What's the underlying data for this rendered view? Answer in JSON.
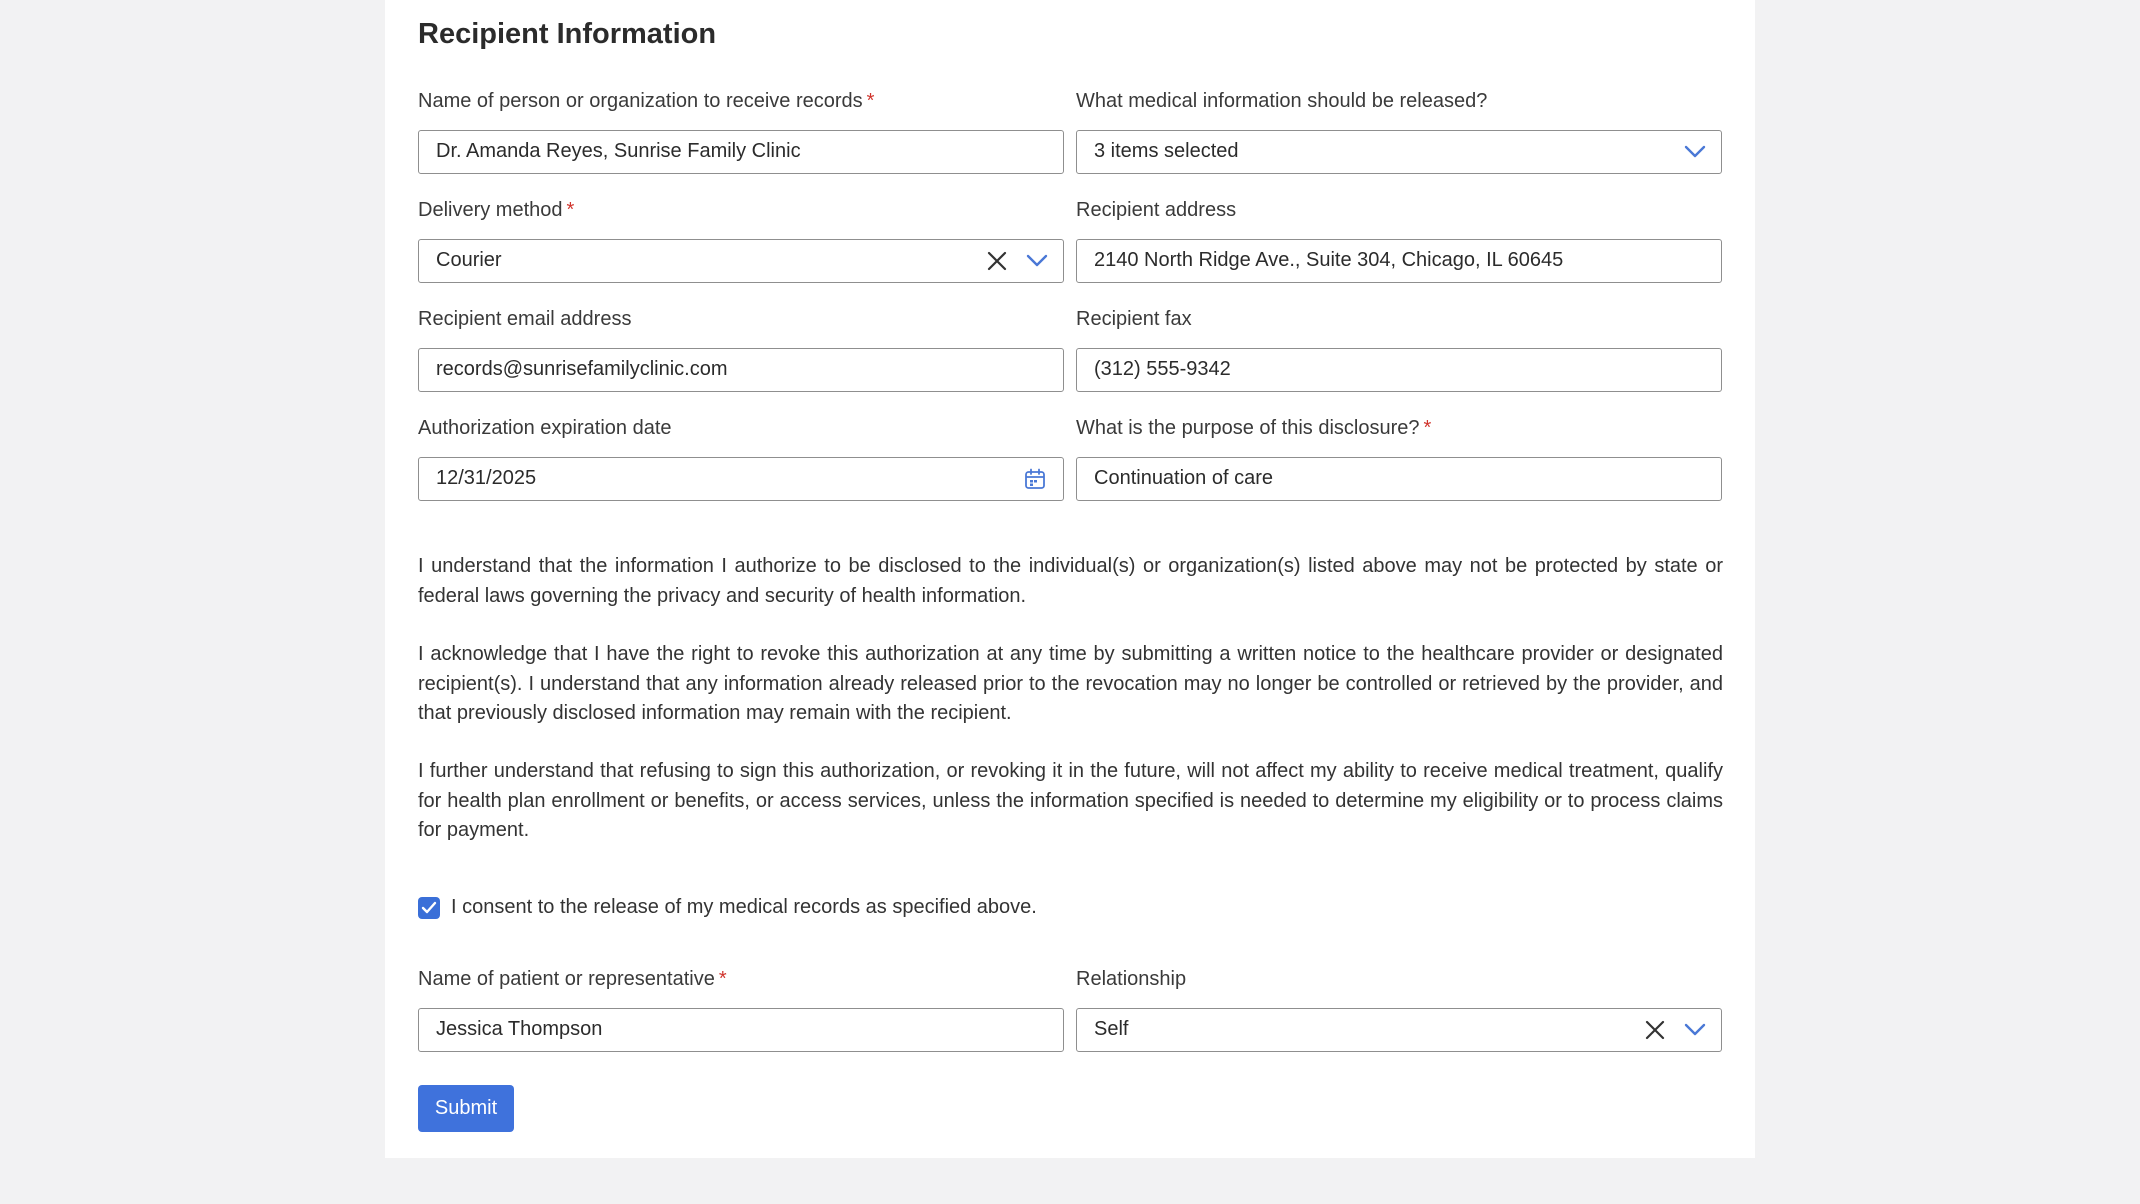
{
  "form": {
    "title": "Recipient Information",
    "fields": {
      "recipient_name": {
        "label": "Name of person or organization to receive records",
        "required_mark": "*",
        "value": "Dr. Amanda Reyes, Sunrise Family Clinic"
      },
      "medical_info": {
        "label": "What medical information should be released?",
        "value": "3 items selected"
      },
      "delivery_method": {
        "label": "Delivery method",
        "required_mark": "*",
        "value": "Courier"
      },
      "recipient_address": {
        "label": "Recipient address",
        "value": "2140 North Ridge Ave., Suite 304, Chicago, IL 60645"
      },
      "recipient_email": {
        "label": "Recipient email address",
        "value": "records@sunrisefamilyclinic.com"
      },
      "recipient_fax": {
        "label": "Recipient fax",
        "value": "(312) 555-9342"
      },
      "expiration_date": {
        "label": "Authorization expiration date",
        "value": "12/31/2025"
      },
      "purpose": {
        "label": "What is the purpose of this disclosure?",
        "required_mark": "*",
        "value": "Continuation of care"
      },
      "patient_name": {
        "label": "Name of patient or representative",
        "required_mark": "*",
        "value": "Jessica Thompson"
      },
      "relationship": {
        "label": "Relationship",
        "value": "Self"
      }
    },
    "paragraphs": {
      "p1": "I understand that the information I authorize to be disclosed to the individual(s) or organization(s) listed above may not be protected by state or federal laws governing the privacy and security of health information.",
      "p2": "I acknowledge that I have the right to revoke this authorization at any time by submitting a written notice to the healthcare provider or designated recipient(s). I understand that any information already released prior to the revocation may no longer be controlled or retrieved by the provider, and that previously disclosed information may remain with the recipient.",
      "p3": "I further understand that refusing to sign this authorization, or revoking it in the future, will not affect my ability to receive medical treatment, qualify for health plan enrollment or benefits, or access services, unless the information specified is needed to determine my eligibility or to process claims for payment."
    },
    "consent": {
      "label": "I consent to the release of my medical records as specified above.",
      "checked": true
    },
    "submit_label": "Submit"
  },
  "colors": {
    "accent": "#3f72dc",
    "required": "#d0342c",
    "icon_blue": "#4a78d6"
  }
}
